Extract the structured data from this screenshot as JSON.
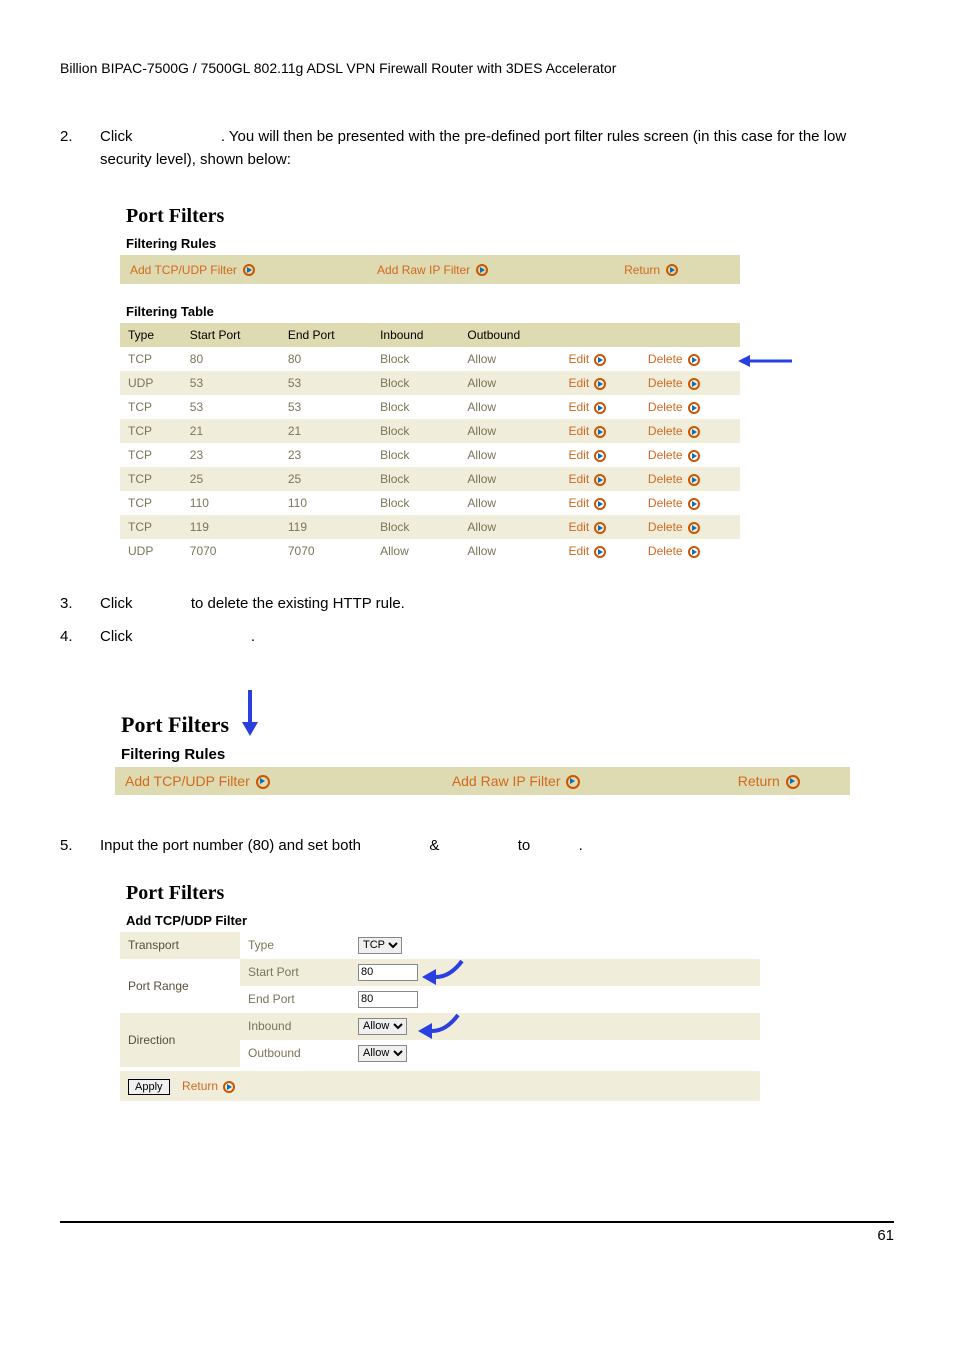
{
  "header": "Billion BIPAC-7500G / 7500GL 802.11g ADSL VPN Firewall Router with 3DES Accelerator",
  "steps": {
    "s2": {
      "num": "2.",
      "prefix": "Click ",
      "suffix": ". You will then be presented with the pre-defined port filter rules screen (in this case for the low security level), shown below:"
    },
    "s3": {
      "num": "3.",
      "prefix": "Click ",
      "suffix": " to delete the existing HTTP rule."
    },
    "s4": {
      "num": "4.",
      "prefix": "Click ",
      "suffix": "."
    },
    "s5": {
      "num": "5.",
      "prefix": "Input the port number (80) and set both ",
      "mid1": " & ",
      "mid2": " to ",
      "suffix": "."
    }
  },
  "panel1": {
    "title": "Port Filters",
    "rules_heading": "Filtering Rules",
    "links": {
      "add_tcp": "Add TCP/UDP Filter",
      "add_raw": "Add Raw IP Filter",
      "return": "Return"
    },
    "table_heading": "Filtering Table",
    "cols": {
      "type": "Type",
      "start": "Start Port",
      "end": "End Port",
      "in": "Inbound",
      "out": "Outbound"
    },
    "edit": "Edit",
    "delete": "Delete",
    "rows": [
      {
        "type": "TCP",
        "start": "80",
        "end": "80",
        "in": "Block",
        "out": "Allow"
      },
      {
        "type": "UDP",
        "start": "53",
        "end": "53",
        "in": "Block",
        "out": "Allow"
      },
      {
        "type": "TCP",
        "start": "53",
        "end": "53",
        "in": "Block",
        "out": "Allow"
      },
      {
        "type": "TCP",
        "start": "21",
        "end": "21",
        "in": "Block",
        "out": "Allow"
      },
      {
        "type": "TCP",
        "start": "23",
        "end": "23",
        "in": "Block",
        "out": "Allow"
      },
      {
        "type": "TCP",
        "start": "25",
        "end": "25",
        "in": "Block",
        "out": "Allow"
      },
      {
        "type": "TCP",
        "start": "110",
        "end": "110",
        "in": "Block",
        "out": "Allow"
      },
      {
        "type": "TCP",
        "start": "119",
        "end": "119",
        "in": "Block",
        "out": "Allow"
      },
      {
        "type": "UDP",
        "start": "7070",
        "end": "7070",
        "in": "Allow",
        "out": "Allow"
      }
    ]
  },
  "panel2": {
    "title": "Port Filters",
    "rules_heading": "Filtering Rules",
    "links": {
      "add_tcp": "Add TCP/UDP Filter",
      "add_raw": "Add Raw IP Filter",
      "return": "Return"
    }
  },
  "panel3": {
    "title": "Port Filters",
    "heading": "Add TCP/UDP Filter",
    "labels": {
      "transport": "Transport",
      "type": "Type",
      "port_range": "Port Range",
      "start": "Start Port",
      "end": "End Port",
      "direction": "Direction",
      "inbound": "Inbound",
      "outbound": "Outbound"
    },
    "values": {
      "type": "TCP",
      "start": "80",
      "end": "80",
      "inbound": "Allow",
      "outbound": "Allow"
    },
    "apply": "Apply",
    "return": "Return"
  },
  "page_number": "61"
}
